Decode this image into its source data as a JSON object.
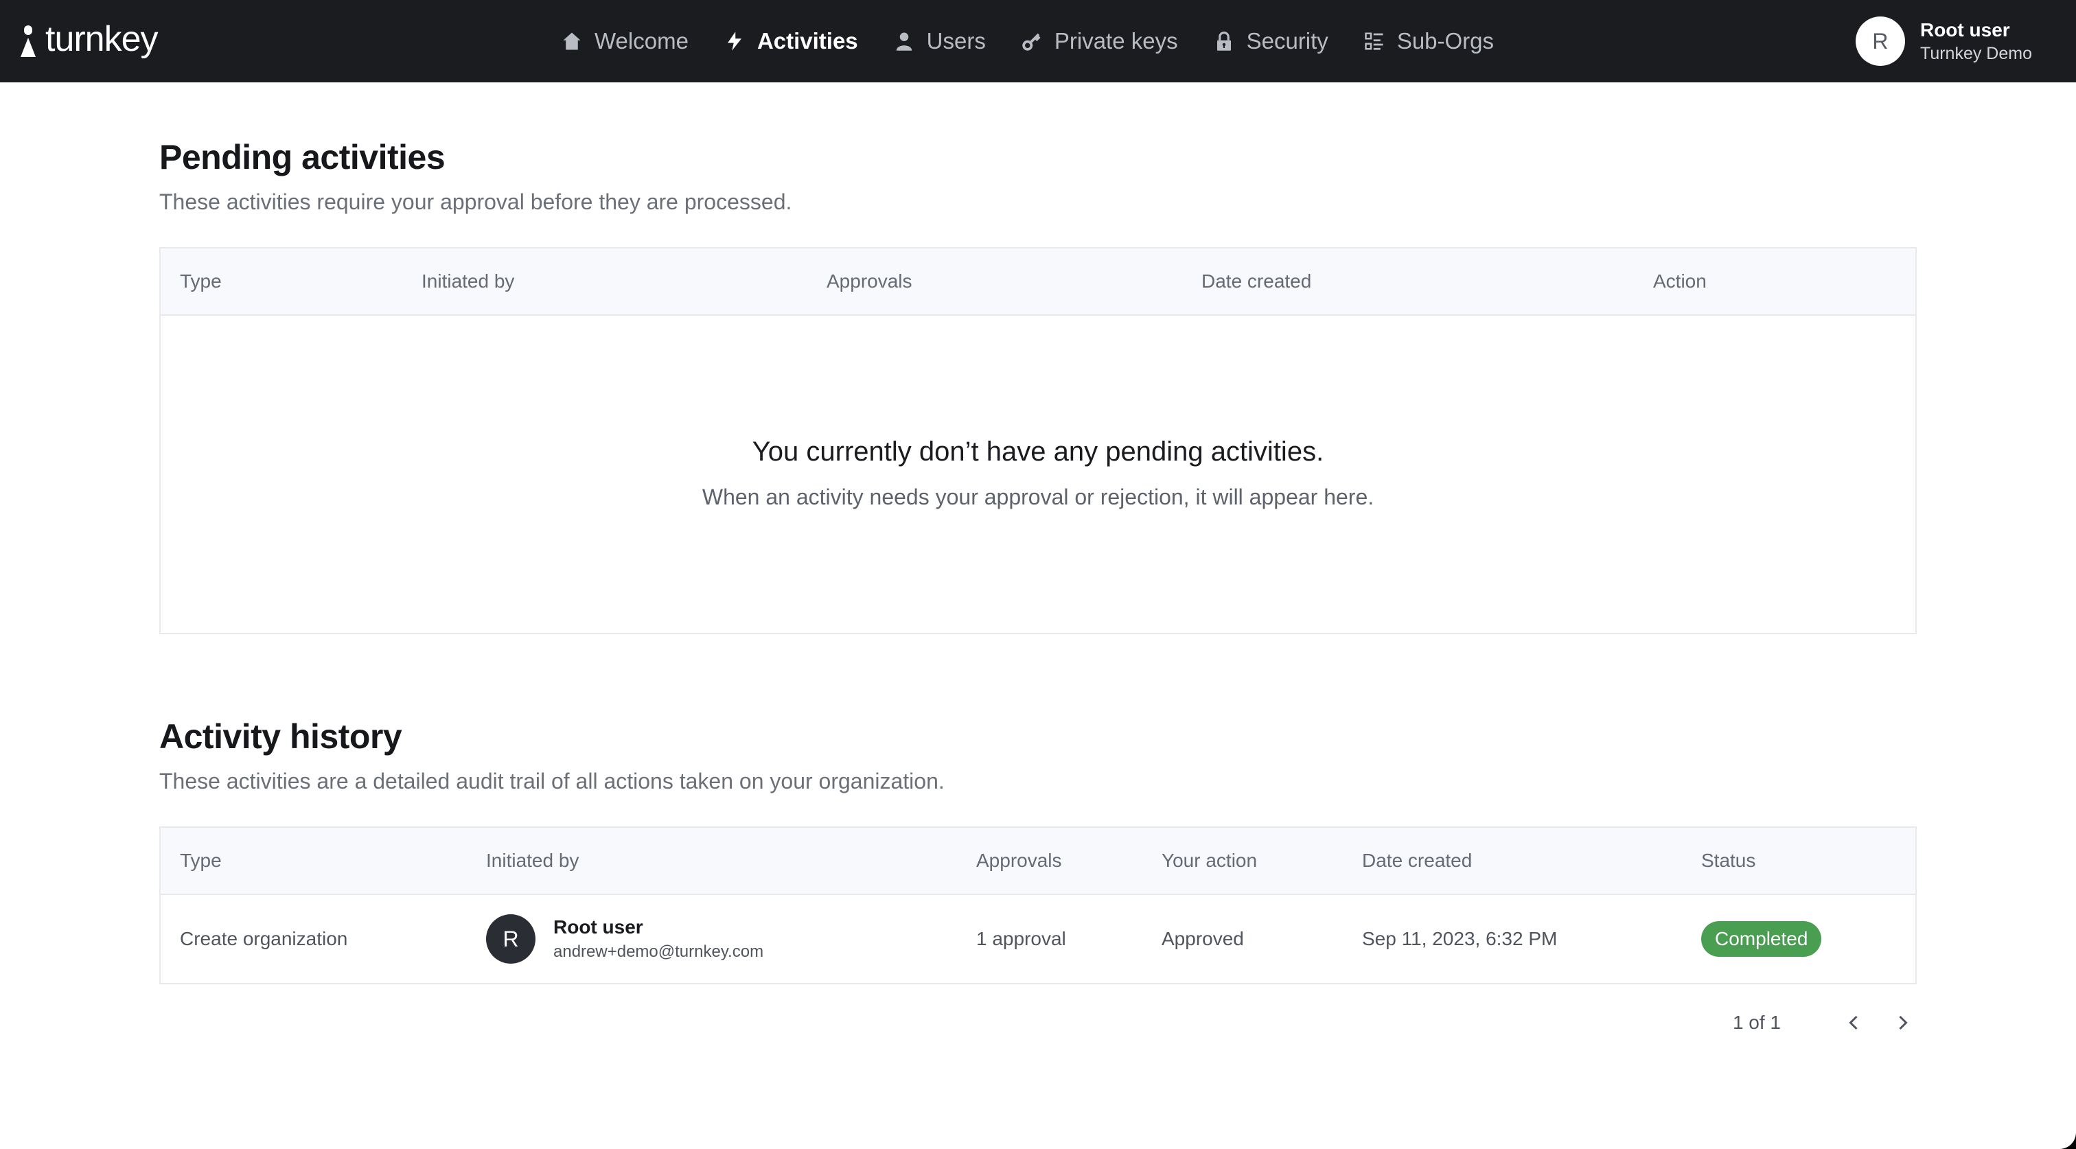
{
  "app": {
    "logo_text": "turnkey"
  },
  "nav": {
    "items": [
      {
        "label": "Welcome",
        "icon": "home-icon",
        "active": false
      },
      {
        "label": "Activities",
        "icon": "lightning-icon",
        "active": true
      },
      {
        "label": "Users",
        "icon": "user-icon",
        "active": false
      },
      {
        "label": "Private keys",
        "icon": "key-icon",
        "active": false
      },
      {
        "label": "Security",
        "icon": "lock-icon",
        "active": false
      },
      {
        "label": "Sub-Orgs",
        "icon": "list-icon",
        "active": false
      }
    ]
  },
  "account": {
    "avatar_initial": "R",
    "name": "Root user",
    "organization": "Turnkey Demo"
  },
  "pending": {
    "title": "Pending activities",
    "subtitle": "These activities require your approval before they are processed.",
    "columns": [
      "Type",
      "Initiated by",
      "Approvals",
      "Date created",
      "Action"
    ],
    "empty_title": "You currently don’t have any pending activities.",
    "empty_subtitle": "When an activity needs your approval or rejection, it will appear here."
  },
  "history": {
    "title": "Activity history",
    "subtitle": "These activities are a detailed audit trail of all actions taken on your organization.",
    "columns": [
      "Type",
      "Initiated by",
      "Approvals",
      "Your action",
      "Date created",
      "Status"
    ],
    "rows": [
      {
        "type": "Create organization",
        "initiator": {
          "initial": "R",
          "name": "Root user",
          "email": "andrew+demo@turnkey.com"
        },
        "approvals": "1 approval",
        "your_action": "Approved",
        "date_created": "Sep 11, 2023, 6:32 PM",
        "status": "Completed",
        "status_color": "#4a9e52"
      }
    ],
    "pagination": {
      "label": "1 of 1",
      "prev_icon": "chevron-left-icon",
      "next_icon": "chevron-right-icon"
    }
  },
  "colors": {
    "topbar_bg": "#1b1c20",
    "success": "#4a9e52",
    "table_header_bg": "#f8f9fc"
  }
}
